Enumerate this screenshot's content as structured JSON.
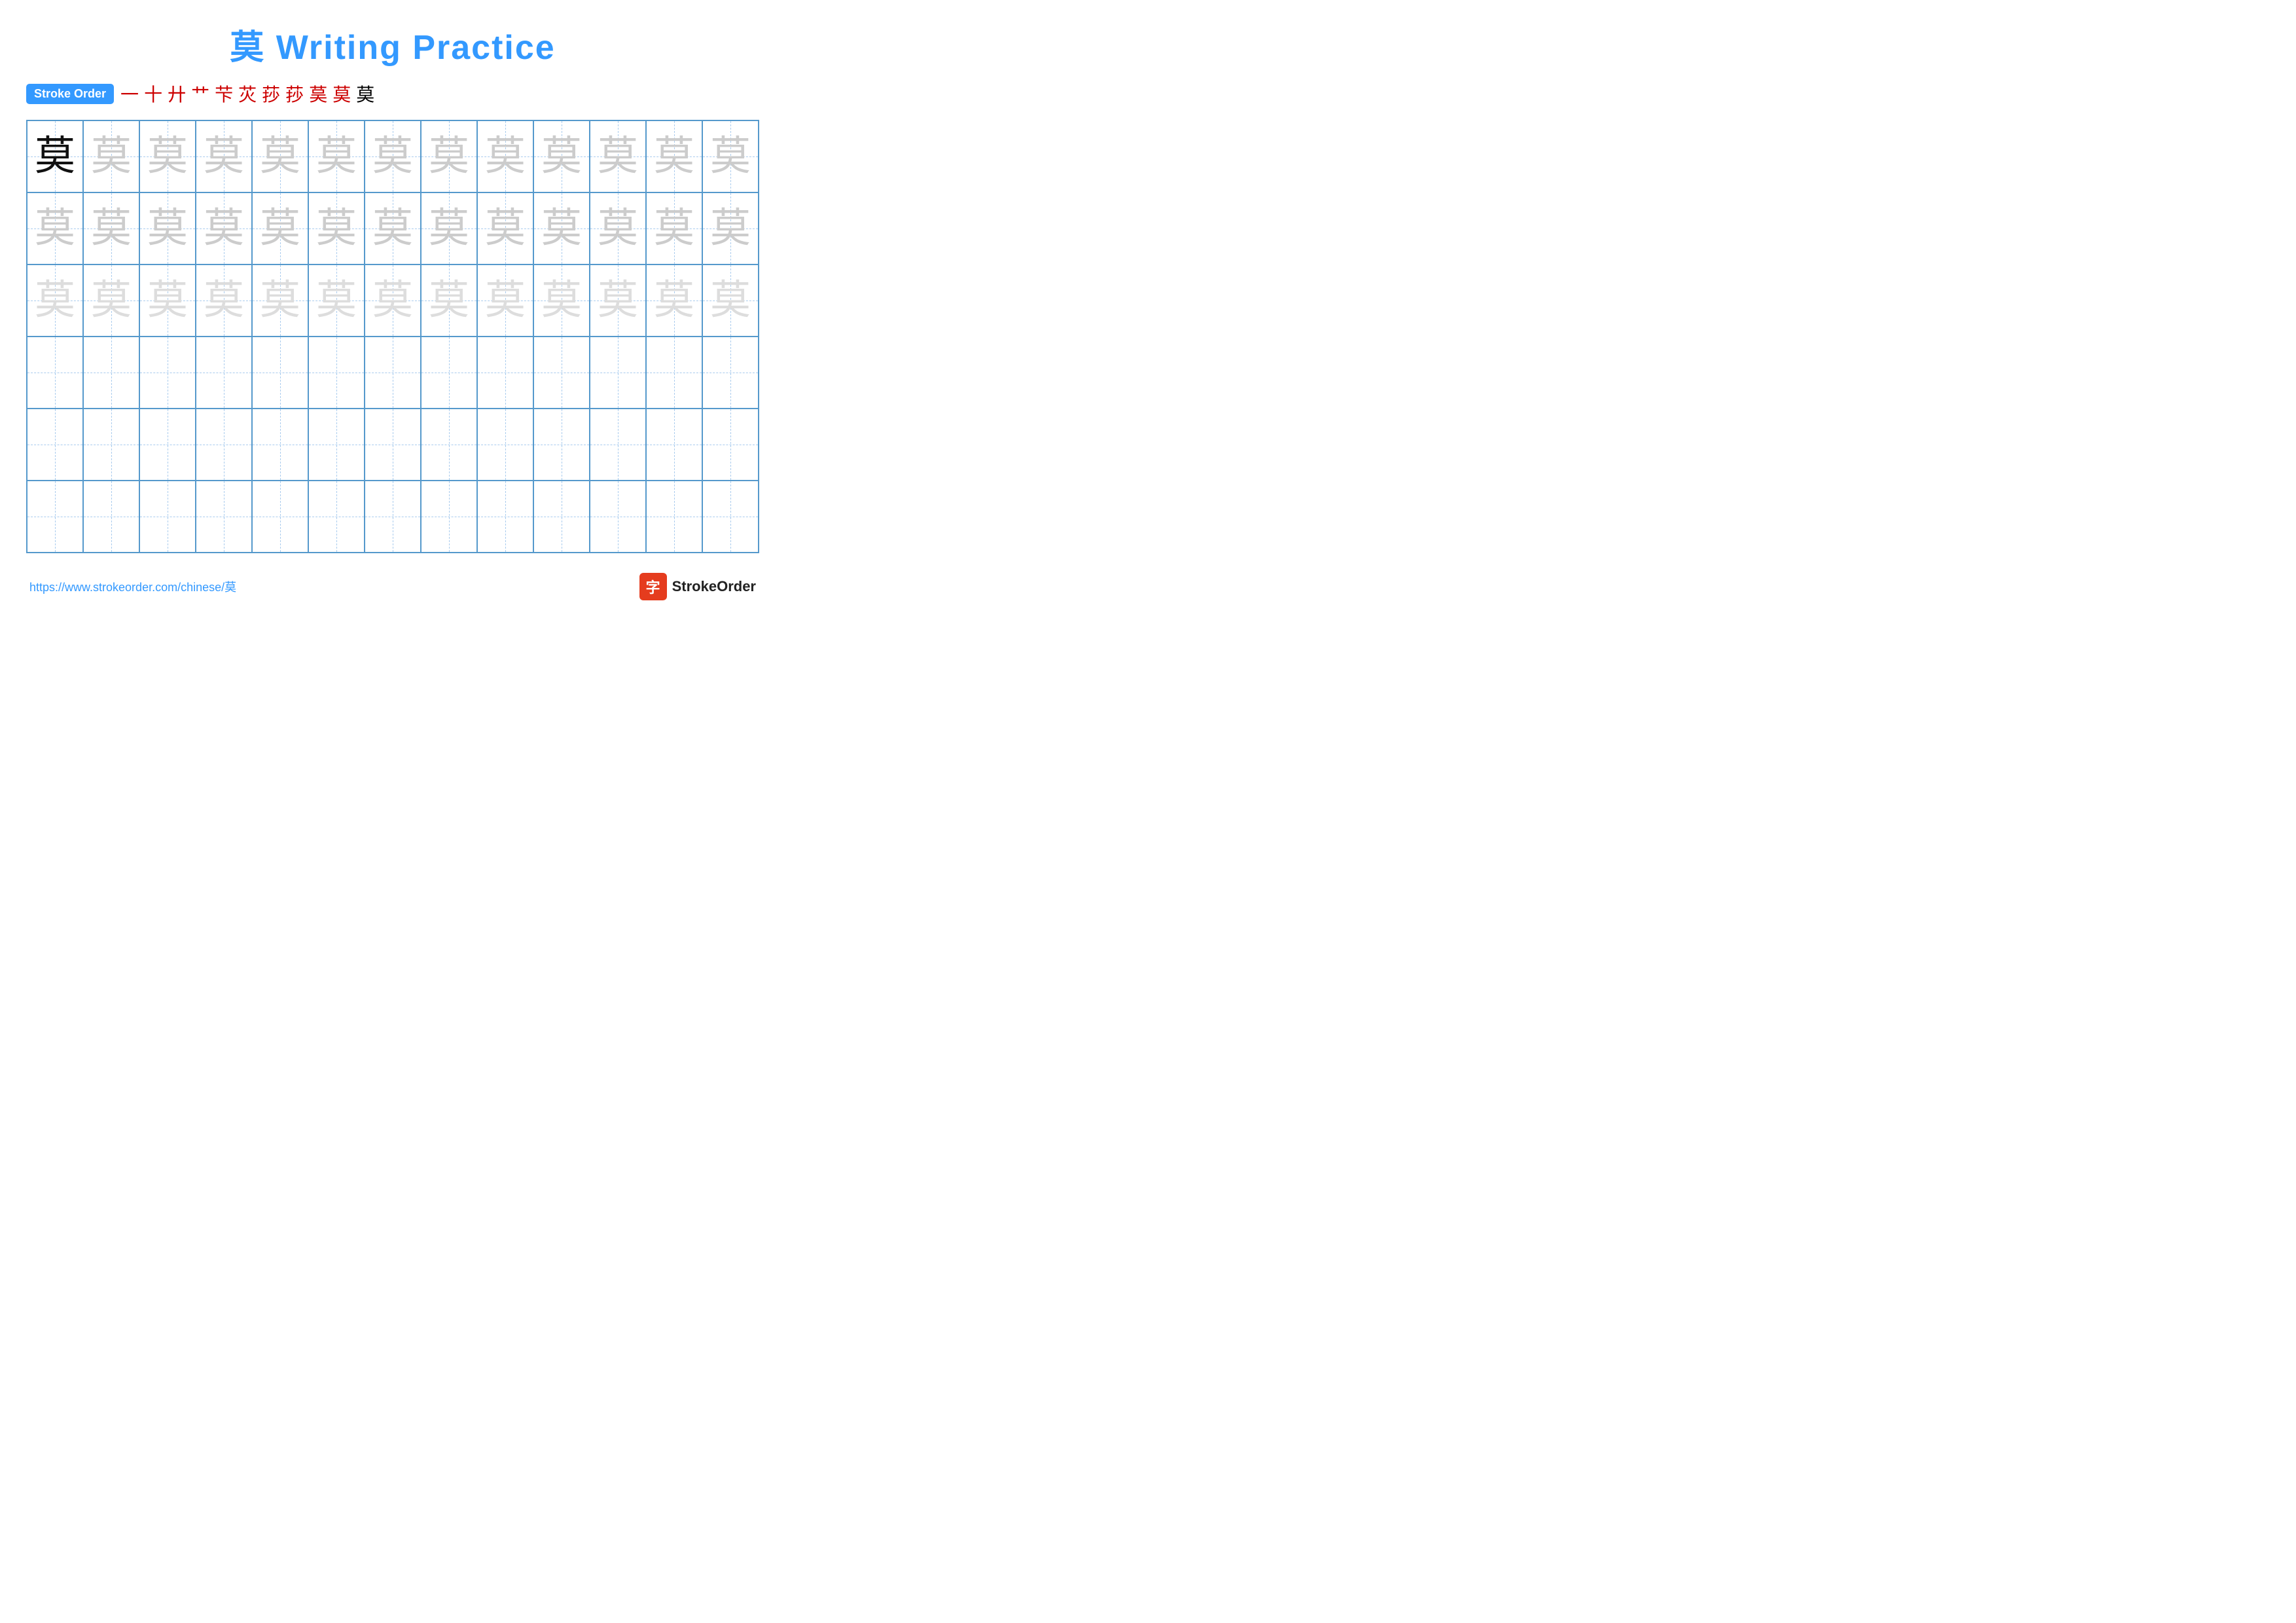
{
  "title": {
    "char": "莫",
    "text": " Writing Practice",
    "full": "莫 Writing Practice"
  },
  "stroke_order": {
    "badge_label": "Stroke Order",
    "steps": [
      "一",
      "十",
      "廾",
      "艹",
      "芐",
      "芐",
      "莏",
      "莏",
      "莐",
      "莫̈",
      "莫"
    ],
    "step_colors": [
      "red",
      "red",
      "red",
      "red",
      "red",
      "red",
      "red",
      "red",
      "red",
      "red",
      "black"
    ]
  },
  "grid": {
    "rows": 6,
    "cols": 13,
    "char": "莫",
    "practice_rows": [
      {
        "shade": "dark",
        "count": 1
      },
      {
        "shade": "medium",
        "count": 12
      },
      {
        "shade": "medium",
        "count": 13
      },
      {
        "shade": "light",
        "count": 13
      },
      {
        "shade": "empty",
        "count": 13
      },
      {
        "shade": "empty",
        "count": 13
      },
      {
        "shade": "empty",
        "count": 13
      }
    ]
  },
  "footer": {
    "url": "https://www.strokeorder.com/chinese/莫",
    "logo_text": "StrokeOrder",
    "logo_icon": "字"
  }
}
